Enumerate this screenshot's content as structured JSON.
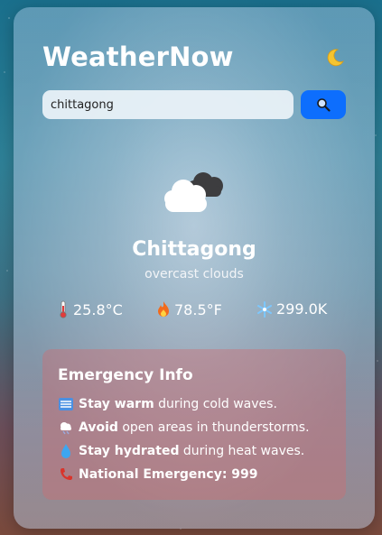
{
  "app": {
    "title": "WeatherNow"
  },
  "search": {
    "value": "chittagong",
    "button_icon": "search-icon"
  },
  "theme_toggle": {
    "icon": "moon-icon"
  },
  "weather": {
    "icon": "cloud-icon",
    "city": "Chittagong",
    "description": "overcast clouds",
    "celsius": "25.8°C",
    "fahrenheit": "78.5°F",
    "kelvin": "299.0K"
  },
  "emergency": {
    "title": "Emergency Info",
    "items": [
      {
        "icon": "cold-wave-icon",
        "bold": "Stay warm",
        "rest": " during cold waves."
      },
      {
        "icon": "storm-cloud-icon",
        "bold": "Avoid",
        "rest": " open areas in thunderstorms."
      },
      {
        "icon": "water-drop-icon",
        "bold": "Stay hydrated",
        "rest": " during heat waves."
      },
      {
        "icon": "phone-icon",
        "bold": "National Emergency: 999",
        "rest": ""
      }
    ]
  },
  "colors": {
    "accent": "#0d6efd",
    "emergency_bg": "#cd6e73"
  }
}
